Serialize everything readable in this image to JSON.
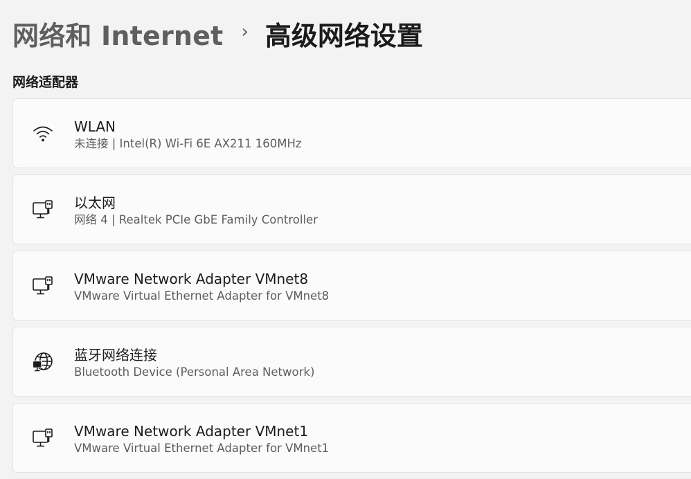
{
  "header": {
    "parent": "网络和 Internet",
    "separator": "›",
    "current": "高级网络设置"
  },
  "section": {
    "title": "网络适配器"
  },
  "adapters": [
    {
      "name": "WLAN",
      "description": "未连接 | Intel(R) Wi-Fi 6E AX211 160MHz",
      "icon": "wifi-icon"
    },
    {
      "name": "以太网",
      "description": "网络 4 | Realtek PCIe GbE Family Controller",
      "icon": "ethernet-icon"
    },
    {
      "name": "VMware Network Adapter VMnet8",
      "description": "VMware Virtual Ethernet Adapter for VMnet8",
      "icon": "ethernet-icon"
    },
    {
      "name": "蓝牙网络连接",
      "description": "Bluetooth Device (Personal Area Network)",
      "icon": "globe-device-icon"
    },
    {
      "name": "VMware Network Adapter VMnet1",
      "description": "VMware Virtual Ethernet Adapter for VMnet1",
      "icon": "ethernet-icon"
    }
  ],
  "colors": {
    "background": "#f3f3f3",
    "card": "#fbfbfb",
    "card_border": "#e3e3e3",
    "text_primary": "#1b1b1b",
    "text_secondary": "#5d5d5d"
  }
}
